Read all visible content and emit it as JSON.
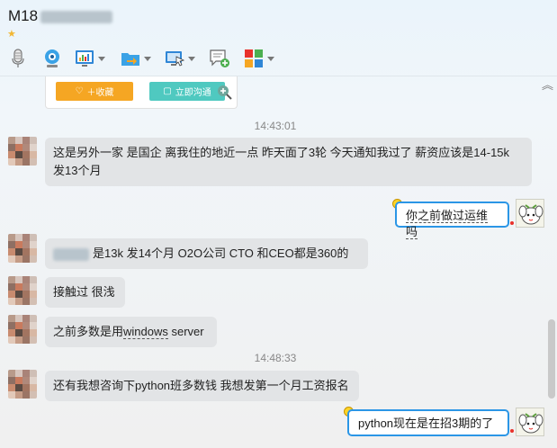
{
  "header": {
    "contact_name": "M18",
    "star_icon": "star-icon"
  },
  "toolbar": {
    "items": [
      {
        "name": "voice-call",
        "icon": "microphone-icon",
        "has_dropdown": false
      },
      {
        "name": "video-call",
        "icon": "webcam-icon",
        "has_dropdown": false
      },
      {
        "name": "screen-share",
        "icon": "chart-screen-icon",
        "has_dropdown": true
      },
      {
        "name": "send-file",
        "icon": "folder-arrow-icon",
        "has_dropdown": true
      },
      {
        "name": "remote-assist",
        "icon": "monitor-cursor-icon",
        "has_dropdown": true
      },
      {
        "name": "create-group",
        "icon": "chat-add-icon",
        "has_dropdown": false
      },
      {
        "name": "apps",
        "icon": "app-grid-icon",
        "has_dropdown": true
      }
    ]
  },
  "card": {
    "fav_label": "＋收藏",
    "chat_label": "立即沟通"
  },
  "messages": {
    "time1": "14:43:01",
    "m1_line1": "这是另外一家 是国企 离我住的地近一点  昨天面了3轮 今天通知我过了  薪资应该是14-15k",
    "m1_line2": "发13个月",
    "r1": "你之前做过运维吗",
    "m2": "是13k 发14个月  O2O公司  CTO 和CEO都是360的",
    "m3": "接触过  很浅",
    "m4_pre": "之前多数是用",
    "m4_ul": "windows",
    "m4_post": " server",
    "time2": "14:48:33",
    "m5": "还有我想咨询下python班多数钱 我想发第一个月工资报名",
    "r2": "python现在是在招3期的了"
  },
  "colors": {
    "accent_blue": "#2b96e6",
    "fav_orange": "#f5a623",
    "chat_teal": "#4fc9c0",
    "incoming_bubble": "#e2e4e6"
  }
}
